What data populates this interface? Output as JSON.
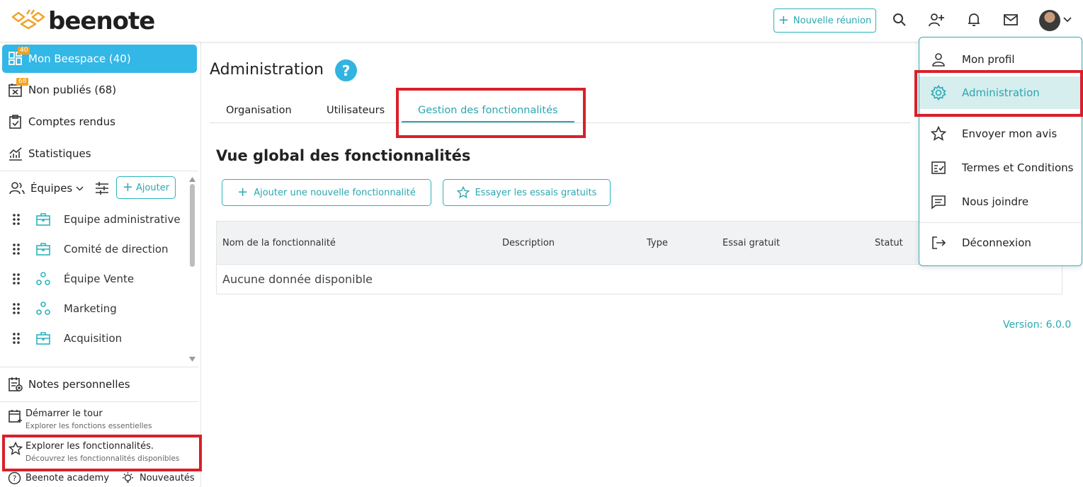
{
  "app": {
    "name": "beenote"
  },
  "header": {
    "new_meeting_label": "Nouvelle réunion",
    "icons": [
      "search-icon",
      "add-user-icon",
      "bell-icon",
      "mail-icon",
      "avatar",
      "chevron-down-icon"
    ]
  },
  "sidebar": {
    "items": [
      {
        "label": "Mon Beespace (40)",
        "badge": "40",
        "icon": "dashboard-icon"
      },
      {
        "label": "Non publiés (68)",
        "badge": "68",
        "icon": "calendar-x-icon"
      },
      {
        "label": "Comptes rendus",
        "icon": "clipboard-check-icon"
      },
      {
        "label": "Statistiques",
        "icon": "chart-icon"
      }
    ],
    "teams_label": "Équipes",
    "add_label": "Ajouter",
    "teams": [
      {
        "label": "Equipe administrative",
        "icon": "briefcase-icon"
      },
      {
        "label": "Comité de direction",
        "icon": "briefcase-icon"
      },
      {
        "label": "Équipe Vente",
        "icon": "group-icon"
      },
      {
        "label": "Marketing",
        "icon": "group-icon"
      },
      {
        "label": "Acquisition",
        "icon": "briefcase-icon"
      }
    ],
    "notes_label": "Notes personnelles",
    "tour": {
      "title": "Démarrer le tour",
      "subtitle": "Explorer les fonctions essentielles"
    },
    "explore": {
      "title": "Explorer les fonctionnalités.",
      "subtitle": "Découvrez les fonctionnalités disponibles"
    },
    "academy_label": "Beenote academy",
    "news_label": "Nouveautés"
  },
  "main": {
    "title": "Administration",
    "help": "?",
    "tabs": [
      {
        "label": "Organisation"
      },
      {
        "label": "Utilisateurs"
      },
      {
        "label": "Gestion des fonctionnalités",
        "active": true
      }
    ],
    "section_title": "Vue global des fonctionnalités",
    "add_feature_label": "Ajouter une nouvelle fonctionnalité",
    "trial_label": "Essayer les essais gratuits",
    "table": {
      "columns": [
        "Nom de la fonctionnalité",
        "Description",
        "Type",
        "Essai gratuit",
        "Statut"
      ],
      "empty_text": "Aucune donnée disponible"
    },
    "version": "Version: 6.0.0"
  },
  "user_menu": {
    "items": [
      {
        "label": "Mon profil",
        "icon": "user-icon"
      },
      {
        "label": "Administration",
        "icon": "gear-icon",
        "active": true
      },
      {
        "label": "Envoyer mon avis",
        "icon": "star-icon"
      },
      {
        "label": "Termes et Conditions",
        "icon": "checklist-icon"
      },
      {
        "label": "Nous joindre",
        "icon": "message-icon"
      },
      {
        "label": "Déconnexion",
        "icon": "logout-icon"
      }
    ]
  },
  "colors": {
    "accent": "#2aa7b1",
    "active_nav": "#33b7e6",
    "badge": "#f3a21c",
    "highlight": "#d8202a"
  }
}
